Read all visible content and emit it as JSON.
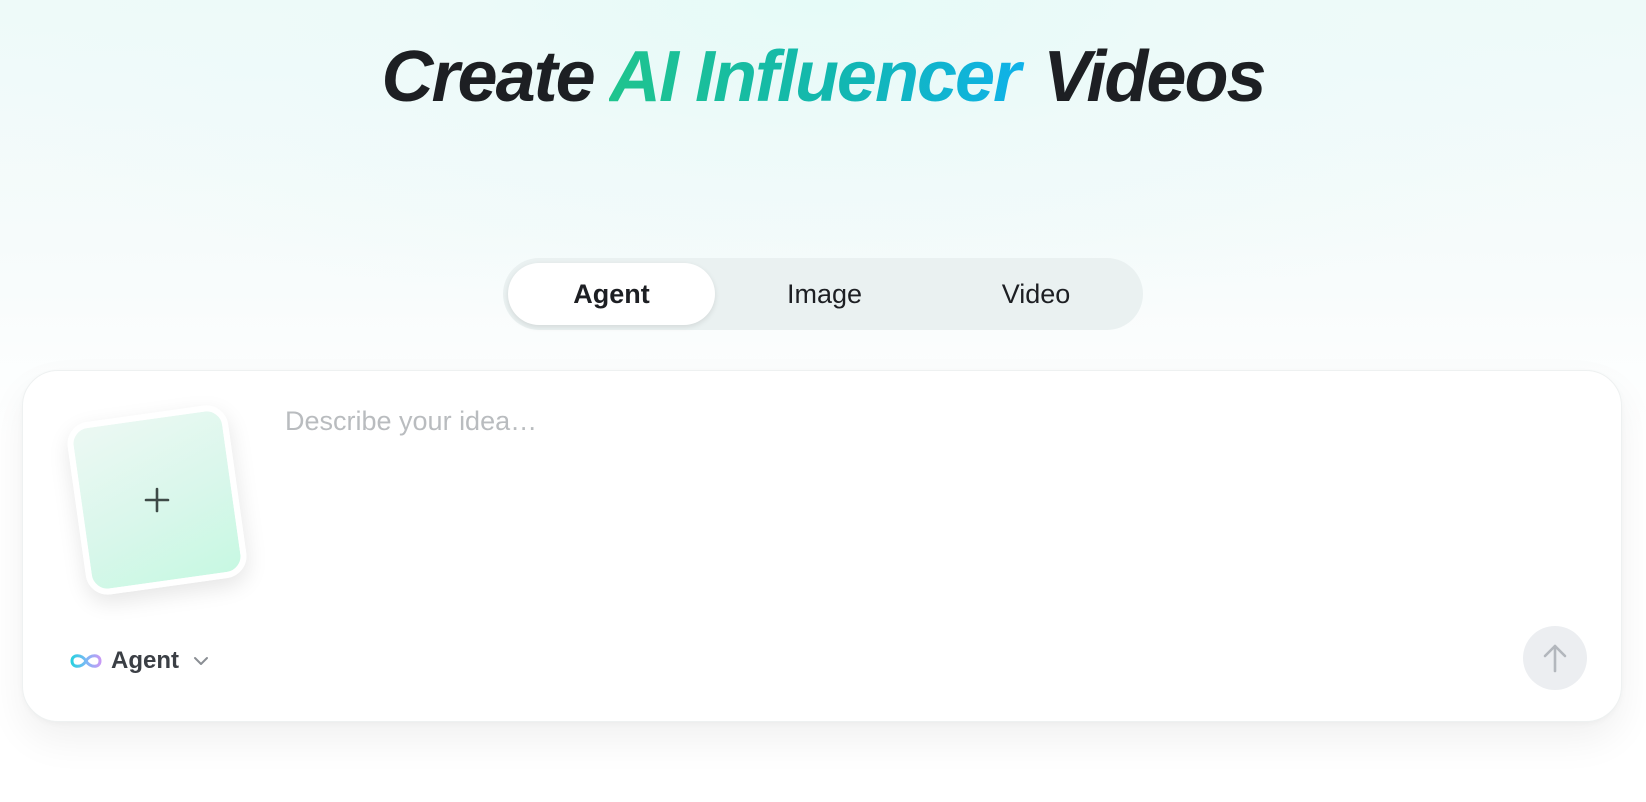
{
  "headline": {
    "prefix": "Create",
    "accent": "AI Influencer",
    "suffix": "Videos"
  },
  "modes": {
    "active": "Agent",
    "items": [
      {
        "label": "Agent"
      },
      {
        "label": "Image"
      },
      {
        "label": "Video"
      }
    ]
  },
  "composer": {
    "placeholder": "Describe your idea…",
    "upload_icon": "plus-icon",
    "agent_selector": {
      "label": "Agent",
      "icon": "infinity-icon",
      "dropdown_icon": "chevron-down-icon"
    },
    "send_icon": "arrow-up-icon"
  },
  "colors": {
    "accent_start": "#1fc48e",
    "accent_end": "#0fb2ea",
    "text": "#1d1f23",
    "placeholder": "#b9bcbf"
  }
}
